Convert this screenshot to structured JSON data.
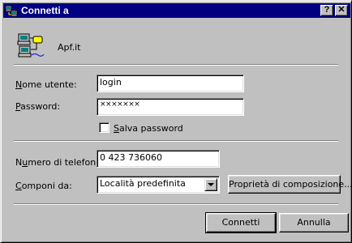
{
  "window": {
    "title": "Connetti a",
    "help_label": "?",
    "close_label": "✕"
  },
  "connection": {
    "name": "Apf.it",
    "icon": "dialup-computers-icon"
  },
  "form": {
    "username_label": "Nome utente:",
    "username_value": "login",
    "password_label": "Password:",
    "password_value": "×××××××",
    "save_password_label": "Salva password",
    "save_password_checked": false,
    "phone_label": "Numero di telefono:",
    "phone_value": "0 423 736060",
    "dial_from_label": "Componi da:",
    "dial_from_value": "Località predefinita",
    "dial_properties_label": "Proprietà di composizione..."
  },
  "buttons": {
    "connect_label": "Connetti",
    "cancel_label": "Annulla"
  },
  "colors": {
    "titlebar": "#000080",
    "face": "#c0c0c0"
  }
}
